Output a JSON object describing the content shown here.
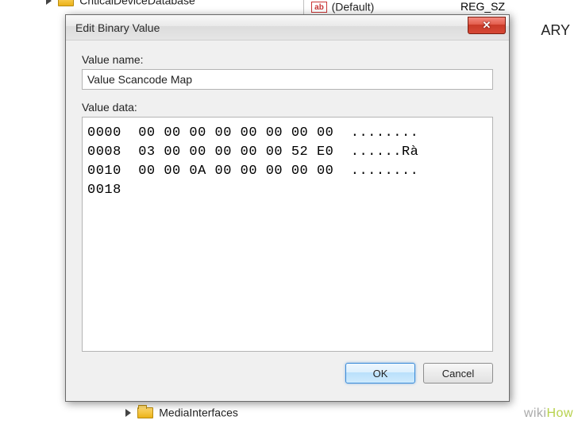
{
  "background": {
    "tree_top_label": "CriticalDeviceDatabase",
    "tree_bottom_label": "MediaInterfaces",
    "row_default_label": "(Default)",
    "row_default_type": "REG_SZ",
    "right_snippet": "ARY"
  },
  "dialog": {
    "title": "Edit Binary Value",
    "value_name_label": "Value name:",
    "value_name": "Value Scancode Map",
    "value_data_label": "Value data:",
    "hex_dump": "0000  00 00 00 00 00 00 00 00  ........\n0008  03 00 00 00 00 00 52 E0  ......Rà\n0010  00 00 0A 00 00 00 00 00  ........\n0018",
    "ok_label": "OK",
    "cancel_label": "Cancel"
  },
  "watermark": {
    "prefix": "wiki",
    "suffix": "How"
  }
}
